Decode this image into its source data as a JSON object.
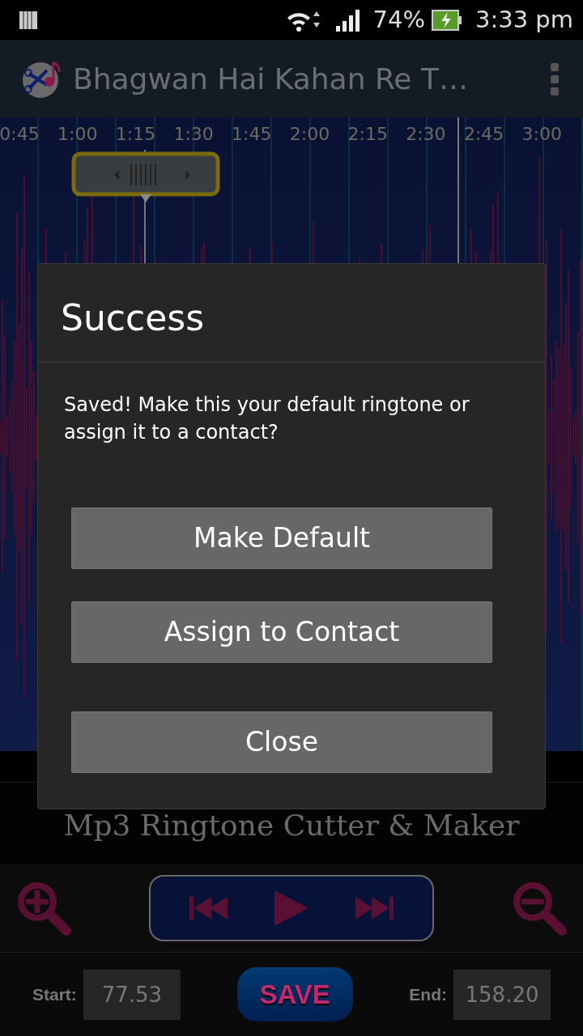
{
  "status_bar": {
    "battery_percent": "74%",
    "time": "3:33 pm"
  },
  "app_bar": {
    "title": "Bhagwan Hai Kahan Re T…"
  },
  "timeline": {
    "labels": [
      "0:45",
      "1:00",
      "1:15",
      "1:30",
      "1:45",
      "2:00",
      "2:15",
      "2:30",
      "2:45",
      "3:00"
    ]
  },
  "dialog": {
    "title": "Success",
    "message": "Saved! Make this your default ringtone or assign it to a contact?",
    "buttons": [
      "Make Default",
      "Assign to Contact",
      "Close"
    ]
  },
  "app_name": "Mp3 Ringtone Cutter & Maker",
  "save_button": "SAVE",
  "start": {
    "label": "Start:",
    "value": "77.53"
  },
  "end": {
    "label": "End:",
    "value": "158.20"
  }
}
